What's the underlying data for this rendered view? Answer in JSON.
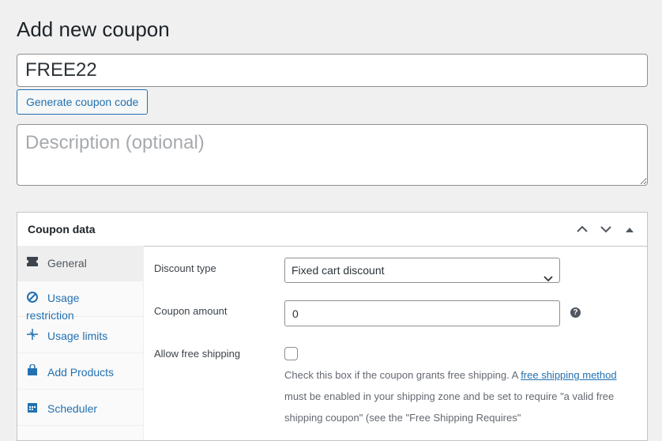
{
  "page": {
    "title": "Add new coupon"
  },
  "coupon": {
    "code_value": "FREE22",
    "generate_label": "Generate coupon code",
    "description_placeholder": "Description (optional)"
  },
  "panel": {
    "title": "Coupon data",
    "header_icons": [
      "chevron-up-icon",
      "chevron-down-icon",
      "toggle-arrow-icon"
    ],
    "tabs": [
      {
        "label": "General",
        "icon": "ticket-icon",
        "active": true
      },
      {
        "label": "Usage restriction",
        "icon": "block-icon",
        "active": false
      },
      {
        "label": "Usage limits",
        "icon": "crosshair-icon",
        "active": false
      },
      {
        "label": "Add Products",
        "icon": "bag-icon",
        "active": false
      },
      {
        "label": "Scheduler",
        "icon": "calendar-icon",
        "active": false
      }
    ],
    "fields": {
      "discount_type_label": "Discount type",
      "discount_type_value": "Fixed cart discount",
      "amount_label": "Coupon amount",
      "amount_value": "0",
      "amount_help": "?",
      "free_shipping_label": "Allow free shipping",
      "free_shipping_checked": false,
      "free_shipping_desc_1": "Check this box if the coupon grants free shipping. A ",
      "free_shipping_link": "free shipping method",
      "free_shipping_desc_2": " must be enabled in your shipping zone and be set to require \"a valid free shipping coupon\" (see the \"Free Shipping Requires\""
    }
  },
  "colors": {
    "accent": "#2271b1",
    "background": "#f0f0f1",
    "active_tab_bg": "#eeeeee"
  }
}
